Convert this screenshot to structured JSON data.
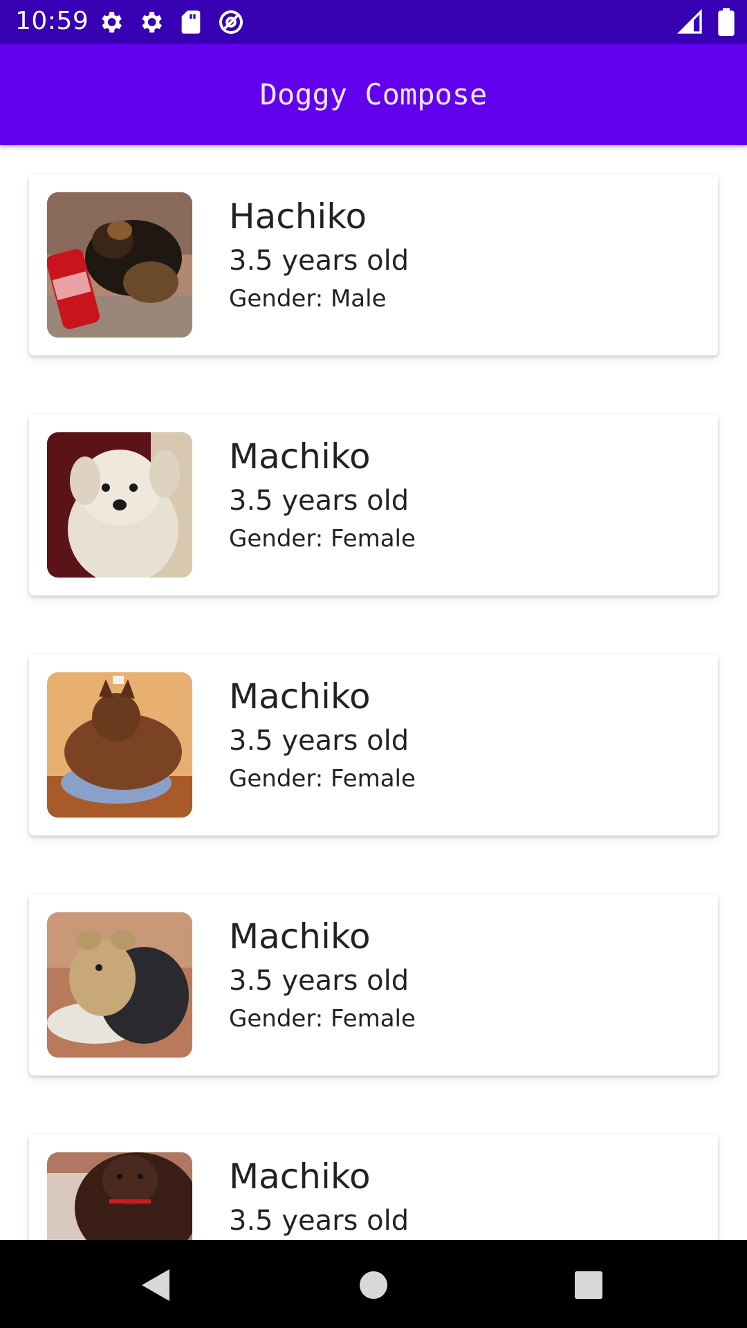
{
  "status_bar": {
    "time": "10:59",
    "left_icons": [
      "settings-icon",
      "settings-icon",
      "sd-card-icon",
      "at-sign-icon"
    ],
    "right_icons": [
      "signal-icon",
      "battery-icon"
    ]
  },
  "app_bar": {
    "title": "Doggy Compose",
    "color": "#6200ee",
    "status_color": "#3700b3"
  },
  "dogs": [
    {
      "name": "Hachiko",
      "age": "3.5 years old",
      "gender": "Gender: Male"
    },
    {
      "name": "Machiko",
      "age": "3.5 years old",
      "gender": "Gender: Female"
    },
    {
      "name": "Machiko",
      "age": "3.5 years old",
      "gender": "Gender: Female"
    },
    {
      "name": "Machiko",
      "age": "3.5 years old",
      "gender": "Gender: Female"
    },
    {
      "name": "Machiko",
      "age": "3.5 years old",
      "gender": ""
    }
  ],
  "nav_bar": {
    "buttons": [
      "back-icon",
      "home-icon",
      "recents-icon"
    ]
  }
}
